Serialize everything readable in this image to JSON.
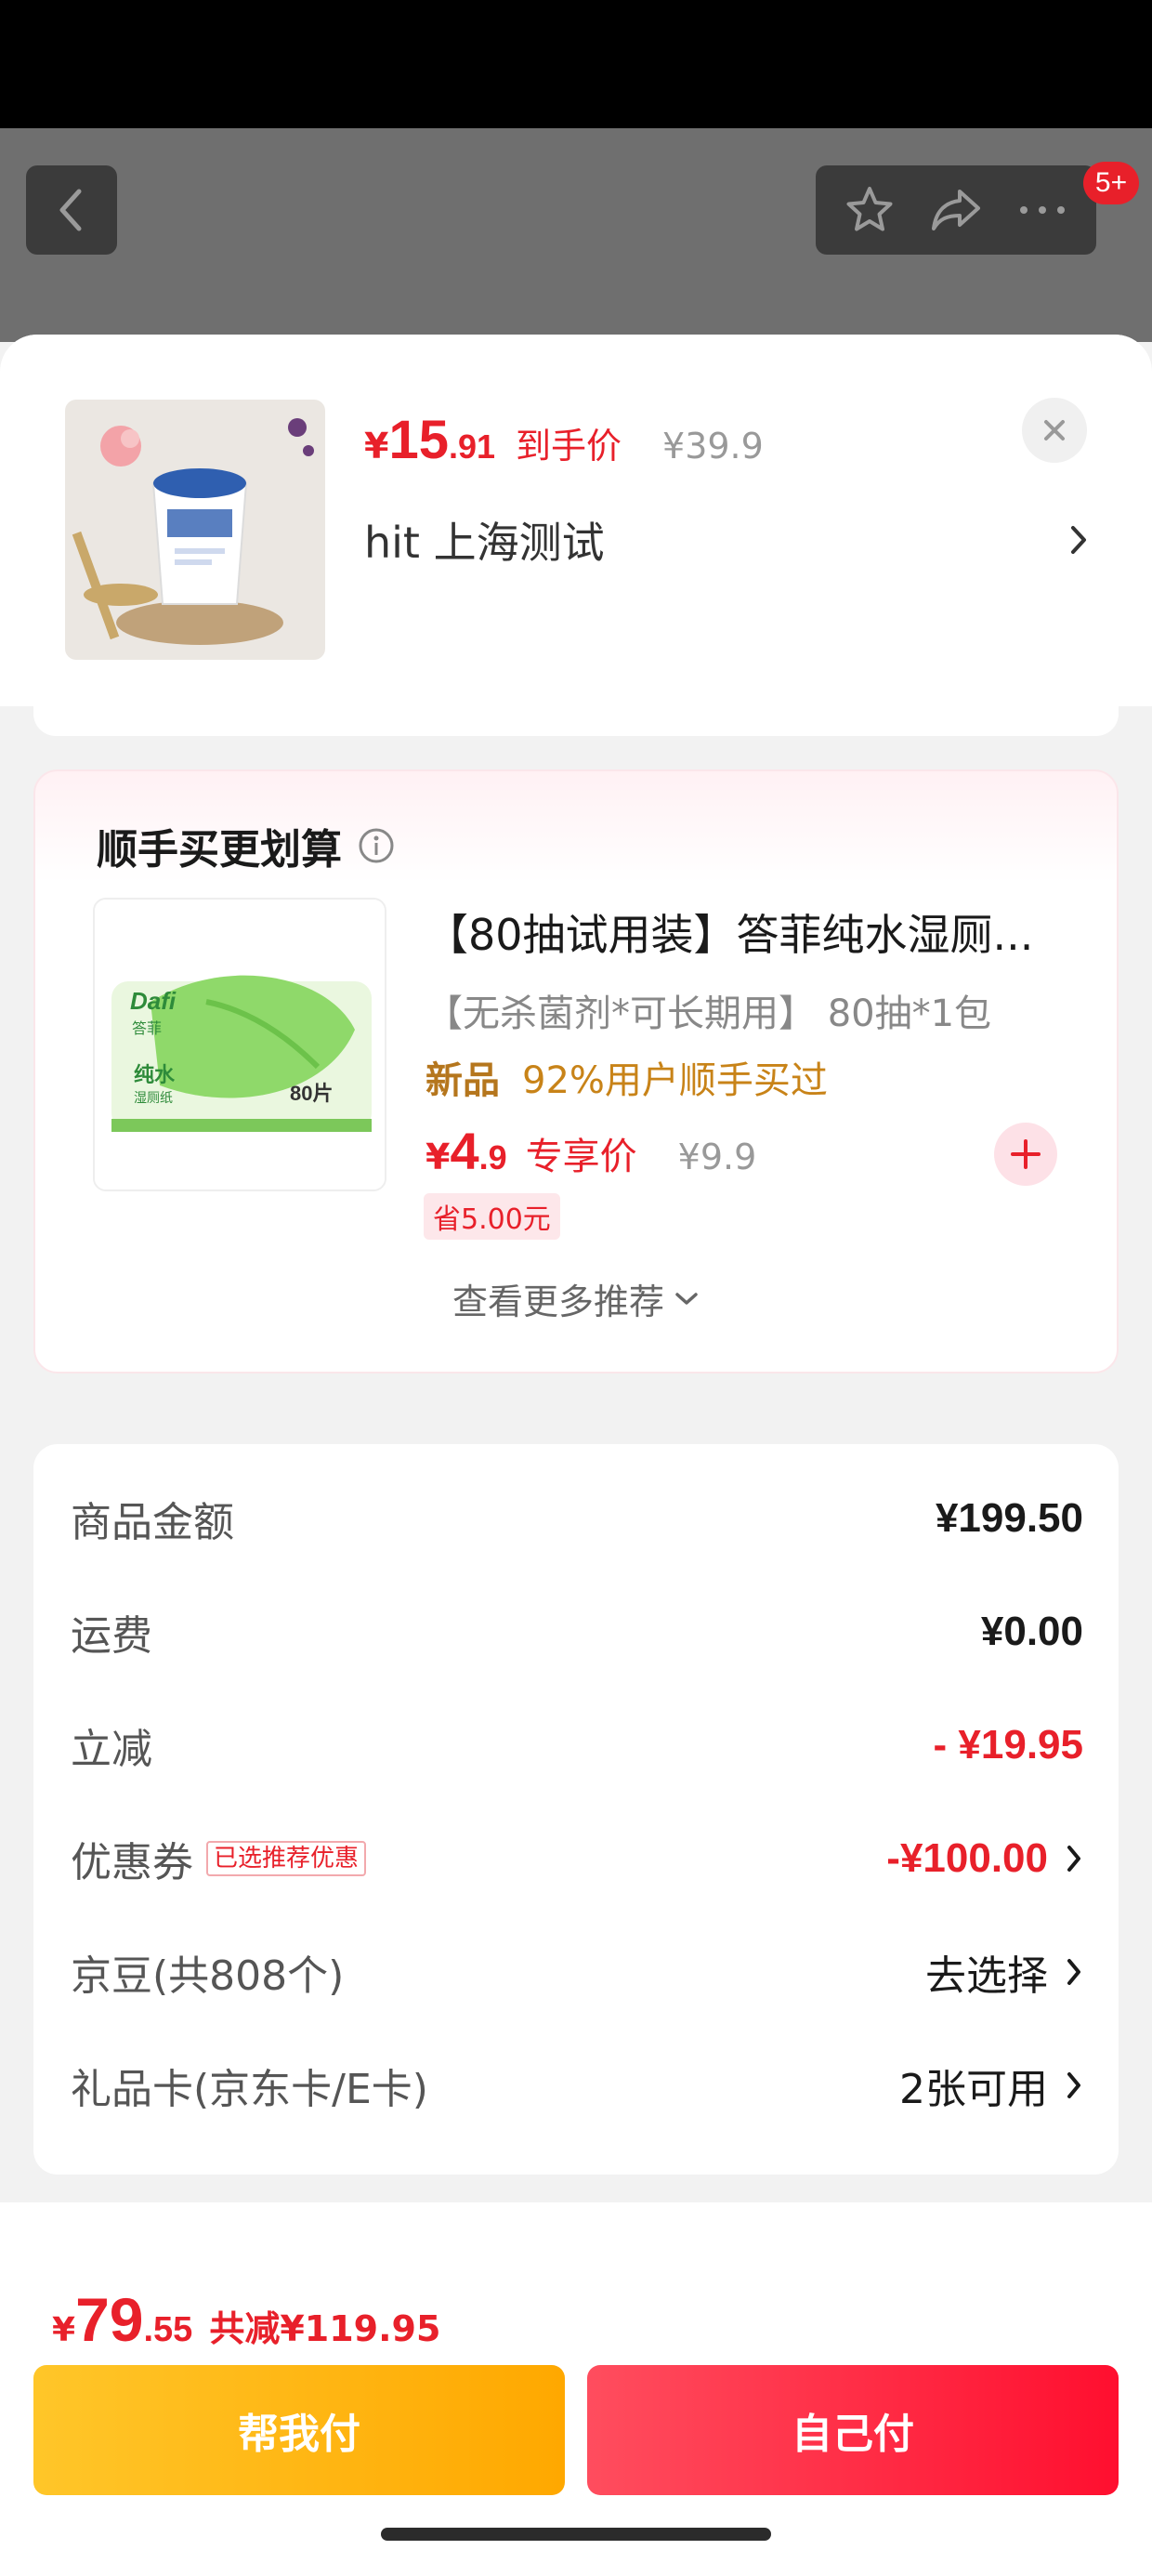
{
  "header": {
    "badge": "5+"
  },
  "product": {
    "currency": "¥",
    "price_int": "15",
    "price_dec": ".91",
    "deal_label": "到手价",
    "original_price": "¥39.9",
    "shop_name": "hit  上海测试"
  },
  "recommend": {
    "title": "顺手买更划算",
    "item": {
      "name": "【80抽试用装】答菲纯水湿厕...",
      "subtitle": "【无杀菌剂*可长期用】 80抽*1包",
      "new_tag": "新品",
      "hot_tag": "92%用户顺手买过",
      "currency": "¥",
      "price_int": "4",
      "price_dec": ".9",
      "exclusive_label": "专享价",
      "original_price": "¥9.9",
      "save_tag": "省5.00元"
    },
    "more_label": "查看更多推荐"
  },
  "summary": {
    "rows": [
      {
        "label": "商品金额",
        "value": "¥199.50"
      },
      {
        "label": "运费",
        "value": "¥0.00"
      },
      {
        "label": "立减",
        "value": "- ¥19.95"
      },
      {
        "label": "优惠券",
        "chip": "已选推荐优惠",
        "value": "-¥100.00"
      },
      {
        "label": "京豆(共808个)",
        "value": "去选择"
      },
      {
        "label": "礼品卡(京东卡/E卡)",
        "value": "2张可用"
      }
    ]
  },
  "footer": {
    "currency": "¥",
    "total_int": "79",
    "total_dec": ".55",
    "total_saved": "共减¥119.95",
    "help_pay": "帮我付",
    "self_pay": "自己付"
  },
  "colors": {
    "accent_red": "#e8202a",
    "gold": "#ffb000",
    "tag_brown": "#b5761d"
  }
}
